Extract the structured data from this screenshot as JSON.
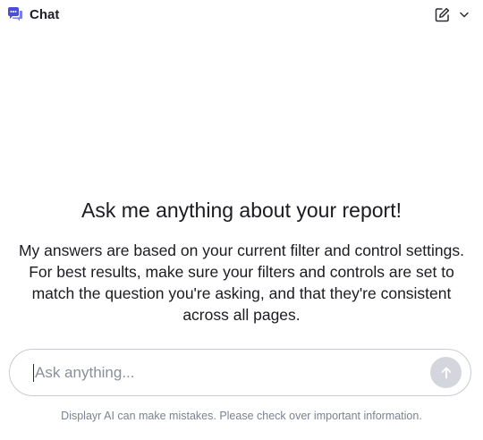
{
  "header": {
    "title": "Chat",
    "logo_icon": "chat-bubbles-icon",
    "new_chat_icon": "edit-icon",
    "menu_icon": "chevron-down-icon"
  },
  "welcome": {
    "title": "Ask me anything about your report!",
    "body": "My answers are based on your current filter and control settings. For best results, make sure your filters and controls are set to match the question you're asking, and that they're consistent across all pages."
  },
  "input": {
    "value": "",
    "placeholder": "Ask anything...",
    "send_icon": "arrow-up-icon"
  },
  "footer": {
    "disclaimer": "Displayr AI can make mistakes. Please check over important information."
  },
  "colors": {
    "brand": "#4b4fd6",
    "send_button_disabled": "#d3d6dc",
    "border": "#c9cbd1",
    "muted_text": "#7b8190"
  }
}
